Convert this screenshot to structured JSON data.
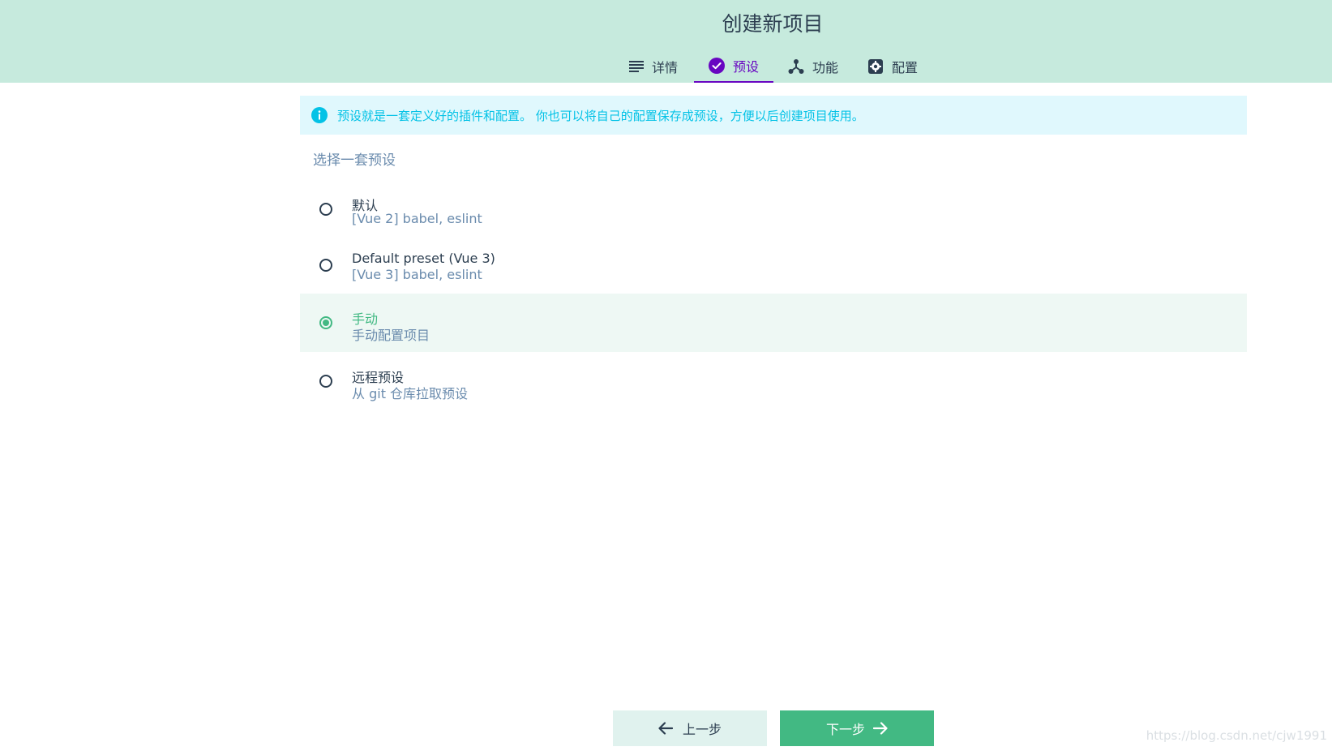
{
  "header": {
    "title": "创建新项目",
    "tabs": [
      {
        "label": "详情",
        "icon": "list-icon",
        "active": false
      },
      {
        "label": "预设",
        "icon": "check-circle-icon",
        "active": true
      },
      {
        "label": "功能",
        "icon": "hub-icon",
        "active": false
      },
      {
        "label": "配置",
        "icon": "settings-gear-icon",
        "active": false
      }
    ]
  },
  "notice": {
    "icon": "info-icon",
    "text": "预设就是一套定义好的插件和配置。 你也可以将自己的配置保存成预设，方便以后创建项目使用。"
  },
  "presets": {
    "title": "选择一套预设",
    "options": [
      {
        "name": "默认",
        "description": "[Vue 2] babel, eslint",
        "selected": false
      },
      {
        "name": "Default preset (Vue 3)",
        "description": "[Vue 3] babel, eslint",
        "selected": false
      },
      {
        "name": "手动",
        "description": "手动配置项目",
        "selected": true
      },
      {
        "name": "远程预设",
        "description": "从 git 仓库拉取预设",
        "selected": false
      }
    ]
  },
  "footer": {
    "prev_label": "上一步",
    "next_label": "下一步"
  },
  "watermark": "https://blog.csdn.net/cjw1991",
  "colors": {
    "header_bg": "#c6eadd",
    "accent_purple": "#6806c1",
    "accent_green": "#42b983",
    "info_blue": "#03c2e6",
    "notice_bg": "#e0f8fd"
  }
}
